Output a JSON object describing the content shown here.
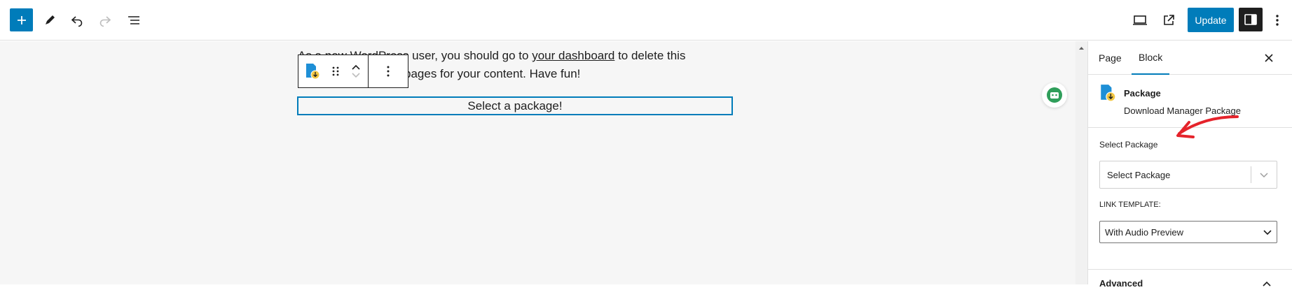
{
  "toolbar": {
    "add_icon": "plus-icon",
    "tools_icon": "pencil-icon",
    "undo_icon": "undo-icon",
    "redo_icon": "redo-icon",
    "outline_icon": "list-view-icon",
    "preview_icon": "desktop-icon",
    "view_icon": "external-link-icon",
    "update_label": "Update",
    "settings_icon": "sidebar-icon",
    "more_icon": "kebab-icon"
  },
  "canvas": {
    "paragraph_line1_prefix": "As a new WordPress user, you should go to ",
    "paragraph_link": "your dashboard",
    "paragraph_line1_suffix": " to delete this",
    "paragraph_line2": "w pages for your content. Have fun!",
    "block_placeholder": "Select a package!"
  },
  "sidebar": {
    "tabs": [
      {
        "label": "Page"
      },
      {
        "label": "Block"
      }
    ],
    "active_tab": "Block",
    "block_title": "Package",
    "block_description": "Download Manager Package",
    "select_package_label": "Select Package",
    "select_package_value": "Select Package",
    "link_template_label": "LINK TEMPLATE:",
    "link_template_value": "With Audio Preview",
    "advanced_label": "Advanced"
  },
  "colors": {
    "accent": "#007cba",
    "annotation": "#e5232b"
  }
}
